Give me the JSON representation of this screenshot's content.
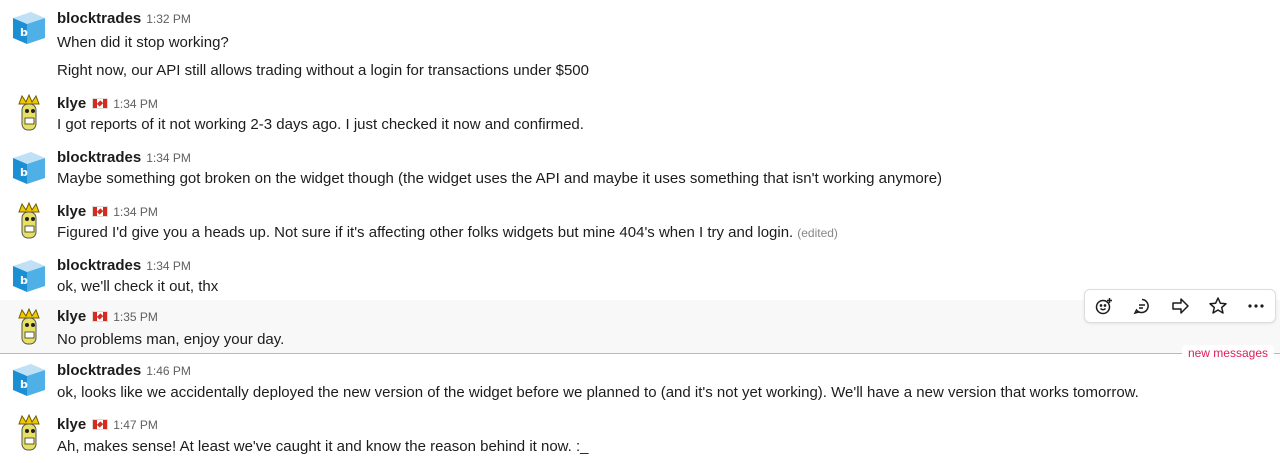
{
  "colors": {
    "new_messages": "#e01e5a",
    "hover_bg": "#f8f8f8",
    "text": "#1d1c1d",
    "muted": "#616061"
  },
  "messages": [
    {
      "author": "blocktrades",
      "time": "1:32 PM",
      "lines": [
        "When did it stop working?",
        "Right now, our API still allows trading without a login for transactions under $500"
      ],
      "avatar": "blocktrades-cube-avatar"
    },
    {
      "author": "klye",
      "flag": "canada-flag",
      "time": "1:34 PM",
      "lines": [
        "I got reports of it not working 2-3 days ago. I just checked it now and confirmed."
      ],
      "avatar": "klye-avatar"
    },
    {
      "author": "blocktrades",
      "time": "1:34 PM",
      "lines": [
        "Maybe something got broken on the widget though (the widget uses the API and maybe it uses something that isn't working anymore)"
      ]
    },
    {
      "author": "klye",
      "flag": "canada-flag",
      "time": "1:34 PM",
      "lines": [
        "Figured I'd give you a heads up. Not sure if it's affecting other folks widgets but mine 404's when I try and login."
      ],
      "edited": "(edited)"
    },
    {
      "author": "blocktrades",
      "time": "1:34 PM",
      "lines": [
        "ok, we'll check it out, thx"
      ]
    },
    {
      "author": "klye",
      "flag": "canada-flag",
      "time": "1:35 PM",
      "lines": [
        "No problems man, enjoy your day."
      ]
    },
    {
      "author": "blocktrades",
      "time": "1:46 PM",
      "lines": [
        "ok, looks like we accidentally deployed the new version of the widget before we planned to (and it's not yet working). We'll have a new version that works tomorrow."
      ]
    },
    {
      "author": "klye",
      "flag": "canada-flag",
      "time": "1:47 PM",
      "lines": [
        "Ah, makes sense! At least we've caught it and know the reason behind it now. :_"
      ]
    }
  ],
  "divider": {
    "label": "new messages"
  },
  "toolbar": {
    "icons": [
      "add-reaction-icon",
      "reply-thread-icon",
      "share-icon",
      "star-icon",
      "more-actions-icon"
    ]
  }
}
